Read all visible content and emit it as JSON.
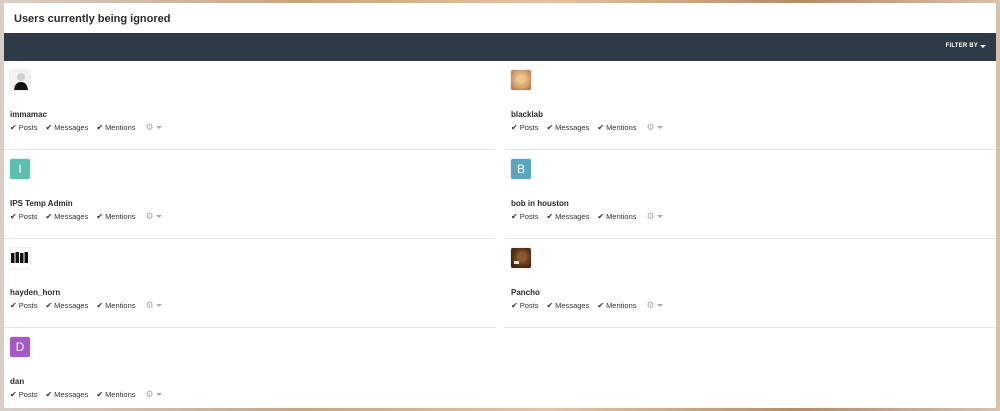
{
  "header": {
    "title": "Users currently being ignored"
  },
  "filter": {
    "label": "FILTER BY"
  },
  "labels": {
    "posts": "Posts",
    "messages": "Messages",
    "mentions": "Mentions"
  },
  "users": [
    {
      "name": "immamac",
      "avatar_letter": ""
    },
    {
      "name": "blacklab",
      "avatar_letter": ""
    },
    {
      "name": "IPS Temp Admin",
      "avatar_letter": "I"
    },
    {
      "name": "bob in houston",
      "avatar_letter": "B"
    },
    {
      "name": "hayden_horn",
      "avatar_letter": ""
    },
    {
      "name": "Pancho",
      "avatar_letter": ""
    },
    {
      "name": "dan",
      "avatar_letter": "D"
    }
  ],
  "colors": {
    "bar": "#2e3a45",
    "avatar_i": "#5cc0b0",
    "avatar_b": "#5aa6bf",
    "avatar_d": "#a35ac4"
  }
}
